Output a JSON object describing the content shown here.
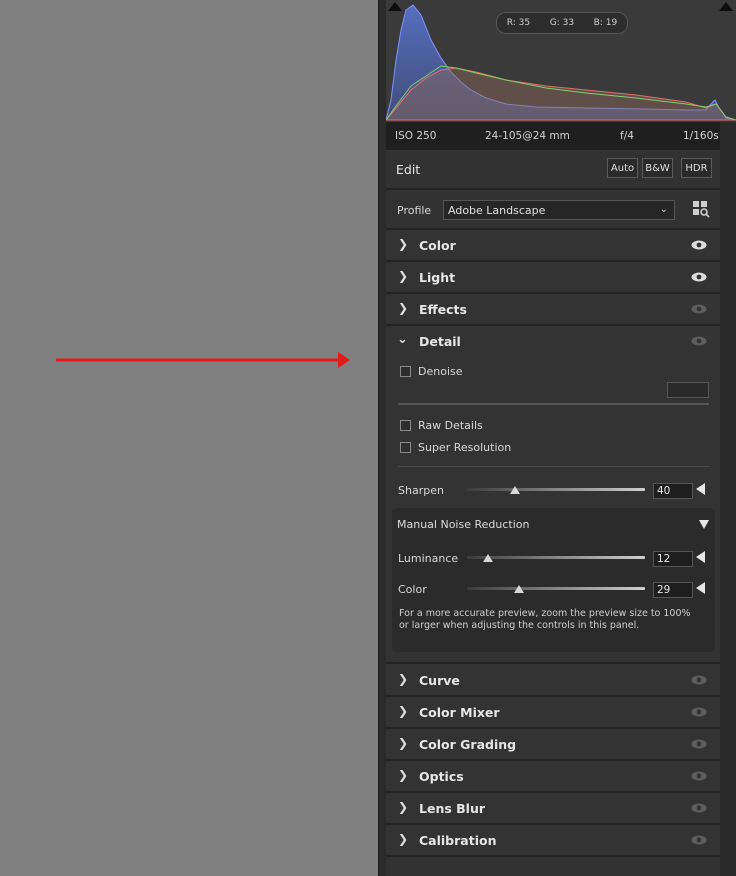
{
  "histogram": {
    "r_label": "R:",
    "r": "35",
    "g_label": "G:",
    "g": "33",
    "b_label": "B:",
    "b": "19"
  },
  "exif": {
    "iso": "ISO 250",
    "lens": "24-105@24 mm",
    "aperture": "f/4",
    "shutter": "1/160s"
  },
  "edit": {
    "title": "Edit",
    "auto": "Auto",
    "bw": "B&W",
    "hdr": "HDR"
  },
  "profile": {
    "label": "Profile",
    "value": "Adobe Landscape"
  },
  "sections_top": [
    {
      "title": "Color",
      "visible": true
    },
    {
      "title": "Light",
      "visible": true
    },
    {
      "title": "Effects",
      "visible": false
    }
  ],
  "detail": {
    "title": "Detail",
    "denoise": "Denoise",
    "raw_details": "Raw Details",
    "super_resolution": "Super Resolution",
    "sharpen": {
      "label": "Sharpen",
      "value": "40",
      "fraction": 0.27
    },
    "noise_reduction": {
      "title": "Manual Noise Reduction",
      "luminance": {
        "label": "Luminance",
        "value": "12",
        "fraction": 0.12
      },
      "color": {
        "label": "Color",
        "value": "29",
        "fraction": 0.29
      },
      "hint": "For a more accurate preview, zoom the preview size to 100% or larger when adjusting the controls in this panel."
    }
  },
  "sections_bottom": [
    {
      "title": "Curve"
    },
    {
      "title": "Color Mixer"
    },
    {
      "title": "Color Grading"
    },
    {
      "title": "Optics"
    },
    {
      "title": "Lens Blur"
    },
    {
      "title": "Calibration"
    }
  ],
  "colors": {
    "annotation_arrow": "#e31b1b",
    "panel": "#333333"
  }
}
